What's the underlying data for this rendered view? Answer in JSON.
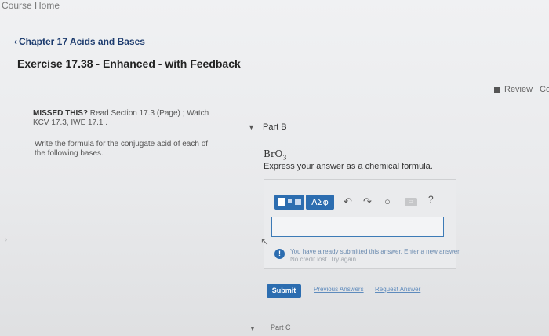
{
  "header": {
    "course_home": "Course Home",
    "chapter_link": "Chapter 17 Acids and Bases",
    "exercise_title": "Exercise 17.38 - Enhanced - with Feedback",
    "review": "Review | Co"
  },
  "left": {
    "missed_bold": "MISSED THIS?",
    "missed_text": " Read Section 17.3 (Page) ; Watch KCV 17.3, IWE 17.1 .",
    "instruction": "Write the formula for the conjugate acid of each of the following bases."
  },
  "part_b": {
    "label": "Part B",
    "formula_base": "BrO",
    "formula_sub": "3",
    "express": "Express your answer as a chemical formula.",
    "toolbar": {
      "greek_label": "ΑΣφ",
      "undo_glyph": "↶",
      "redo_glyph": "↷",
      "reset_glyph": "○",
      "keyboard_label": "▭",
      "help_label": "?"
    },
    "warning_line1": "You have already submitted this answer. Enter a new answer.",
    "warning_line2": "No credit lost. Try again.",
    "submit_label": "Submit",
    "previous_answers": "Previous Answers",
    "request_answer": "Request Answer"
  },
  "part_c": {
    "label": "Part C"
  }
}
